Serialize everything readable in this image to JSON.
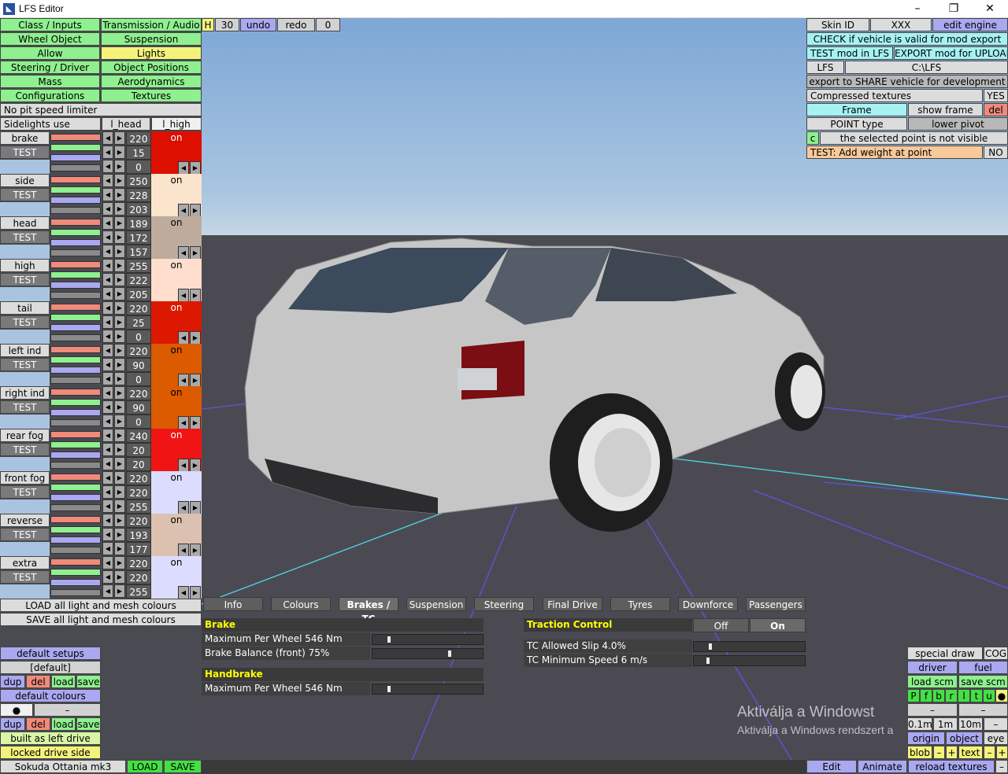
{
  "window": {
    "title": "LFS Editor",
    "minimize": "–",
    "maximize": "❐",
    "close": "✕"
  },
  "left_menu": [
    [
      "Class / Inputs",
      "Transmission / Audio"
    ],
    [
      "Wheel Object",
      "Suspension"
    ],
    [
      "Allow",
      "Lights"
    ],
    [
      "Steering / Driver",
      "Object Positions"
    ],
    [
      "Mass",
      "Aerodynamics"
    ],
    [
      "Configurations",
      "Textures"
    ]
  ],
  "top_toolbar": {
    "h": "H",
    "num": "30",
    "undo": "undo",
    "redo": "redo",
    "zero": "0"
  },
  "no_pit": "No pit speed limiter",
  "sidelights": {
    "label": "Sidelights use",
    "l_head": "l_head",
    "l_high": "l_high"
  },
  "test_label": "TEST",
  "lights": [
    {
      "name": "brake",
      "r": "220",
      "g": "15",
      "b": "0",
      "state": "on",
      "color": "#dc0f00",
      "txt": "#fff"
    },
    {
      "name": "side",
      "r": "250",
      "g": "228",
      "b": "203",
      "state": "on",
      "color": "#fae4cb",
      "txt": "#000"
    },
    {
      "name": "head",
      "r": "189",
      "g": "172",
      "b": "157",
      "state": "on",
      "color": "#bdac9d",
      "txt": "#000"
    },
    {
      "name": "high",
      "r": "255",
      "g": "222",
      "b": "205",
      "state": "on",
      "color": "#ffdecd",
      "txt": "#000"
    },
    {
      "name": "tail",
      "r": "220",
      "g": "25",
      "b": "0",
      "state": "on",
      "color": "#dc1900",
      "txt": "#fff"
    },
    {
      "name": "left ind",
      "r": "220",
      "g": "90",
      "b": "0",
      "state": "on",
      "color": "#dc5a00",
      "txt": "#000"
    },
    {
      "name": "right ind",
      "r": "220",
      "g": "90",
      "b": "0",
      "state": "on",
      "color": "#dc5a00",
      "txt": "#000"
    },
    {
      "name": "rear fog",
      "r": "240",
      "g": "20",
      "b": "20",
      "state": "on",
      "color": "#f01414",
      "txt": "#fff"
    },
    {
      "name": "front fog",
      "r": "220",
      "g": "220",
      "b": "255",
      "state": "on",
      "color": "#dcdcff",
      "txt": "#000"
    },
    {
      "name": "reverse",
      "r": "220",
      "g": "193",
      "b": "177",
      "state": "on",
      "color": "#dcc1b1",
      "txt": "#000"
    },
    {
      "name": "extra",
      "r": "220",
      "g": "220",
      "b": "255",
      "state": "on",
      "color": "#dcdcff",
      "txt": "#000"
    }
  ],
  "load_colours": "LOAD all light and mesh colours",
  "save_colours": "SAVE all light and mesh colours",
  "setups": {
    "default_setups": "default setups",
    "default": "[default]",
    "dup": "dup",
    "del": "del",
    "load": "load",
    "save": "save",
    "default_colours": "default colours",
    "dot": "●",
    "dash": "–",
    "built": "built as left drive",
    "locked": "locked drive side"
  },
  "vehicle": {
    "name": "Sokuda Ottania mk3",
    "load": "LOAD",
    "save": "SAVE"
  },
  "right_panel": {
    "skin_id": "Skin ID",
    "xxx": "XXX",
    "edit_engine": "edit engine",
    "check": "CHECK if vehicle is valid for mod export",
    "test_mod": "TEST mod in LFS",
    "export_mod": "EXPORT mod for UPLOAD",
    "lfs": "LFS",
    "path": "C:\\LFS",
    "export_share": "export to SHARE vehicle for development",
    "compressed": "Compressed textures",
    "yes": "YES",
    "frame": "Frame",
    "show_frame": "show frame",
    "del": "del",
    "point_type": "POINT type",
    "lower_pivot": "lower pivot",
    "c": "c",
    "not_visible": "the selected point is not visible",
    "test_weight": "TEST: Add weight at point",
    "no": "NO"
  },
  "bottom_right": {
    "special_draw": "special draw",
    "cog": "COG",
    "driver": "driver",
    "fuel": "fuel",
    "load_scm": "load scm",
    "save_scm": "save scm",
    "letters": [
      "P",
      "f",
      "b",
      "r",
      "l",
      "t",
      "u",
      "●"
    ],
    "dash1": "–",
    "dash2": "–",
    "m01": "0.1m",
    "m1": "1m",
    "m10": "10m",
    "mdash": "–",
    "origin": "origin",
    "object": "object",
    "eye": "eye",
    "blob": "blob",
    "minus": "–",
    "plus": "+",
    "text": "text"
  },
  "bottom_bar": {
    "edit": "Edit",
    "animate": "Animate",
    "reload": "reload textures",
    "dash": "–"
  },
  "tabs": [
    "Info",
    "Colours",
    "Brakes / TC",
    "Suspension",
    "Steering",
    "Final Drive",
    "Tyres",
    "Downforce",
    "Passengers"
  ],
  "brakes": {
    "brake_head": "Brake",
    "max_wheel": "Maximum Per Wheel 546 Nm",
    "balance": "Brake Balance (front) 75%",
    "handbrake_head": "Handbrake",
    "hb_max": "Maximum Per Wheel 546 Nm",
    "max_wheel_value": 0.03,
    "balance_value": 0.75,
    "hb_value": 0.03
  },
  "tc": {
    "head": "Traction Control",
    "off": "Off",
    "on": "On",
    "slip": "TC Allowed Slip 4.0%",
    "speed": "TC Minimum Speed 6 m/s",
    "slip_value": 0.03,
    "speed_value": 0.0
  },
  "watermark": {
    "line1": "Aktiválja a Windowst",
    "line2": "Aktiválja a Windows rendszert a"
  },
  "colors": {
    "sky": "#8fb2da",
    "ground": "#4b4a53",
    "car": "#c4c4c4"
  }
}
